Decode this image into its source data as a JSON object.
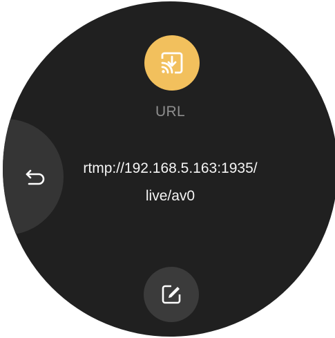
{
  "screen": {
    "title": "URL",
    "url_line1": "rtmp://192.168.5.163:1935/",
    "url_line2": "live/av0"
  },
  "icons": {
    "header": "cast-download-icon",
    "back": "back-arrow-icon",
    "edit": "edit-pencil-icon"
  },
  "colors": {
    "background": "#202020",
    "accent": "#f2c05d",
    "label": "#8e8e8e",
    "text": "#f4f4f4",
    "button": "#3b3b3b"
  }
}
